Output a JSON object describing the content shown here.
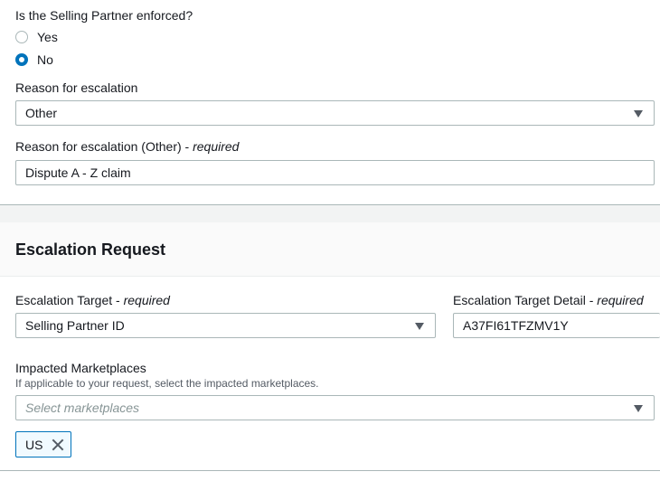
{
  "enforced_question": {
    "label": "Is the Selling Partner enforced?",
    "options": [
      {
        "label": "Yes",
        "selected": false
      },
      {
        "label": "No",
        "selected": true
      }
    ]
  },
  "reason": {
    "label": "Reason for escalation",
    "value": "Other"
  },
  "reason_other": {
    "label": "Reason for escalation (Other)",
    "required_suffix": "required",
    "value": "Dispute A - Z claim"
  },
  "escalation_request": {
    "title": "Escalation Request",
    "target": {
      "label": "Escalation Target",
      "required_suffix": "required",
      "value": "Selling Partner ID"
    },
    "target_detail": {
      "label": "Escalation Target Detail",
      "required_suffix": "required",
      "value": "A37FI61TFZMV1Y"
    },
    "marketplaces": {
      "label": "Impacted Marketplaces",
      "description": "If applicable to your request, select the impacted marketplaces.",
      "placeholder": "Select marketplaces",
      "selected_tokens": [
        "US"
      ]
    }
  },
  "colors": {
    "accent": "#0073bb",
    "border": "#aab7b8",
    "text": "#16191f",
    "muted": "#545b64"
  }
}
